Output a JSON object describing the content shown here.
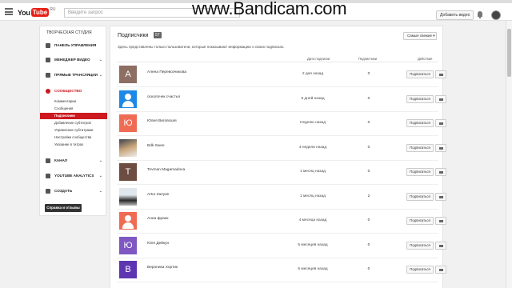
{
  "header": {
    "logo_you": "You",
    "logo_tube": "Tube",
    "logo_sup": "RU",
    "search_text": "Введите запрос",
    "upload_label": "Добавить видео",
    "watermark": "www.Bandicam.com"
  },
  "sidebar": {
    "title": "ТВОРЧЕСКАЯ СТУДИЯ",
    "items": [
      {
        "label": "ПАНЕЛЬ УПРАВЛЕНИЯ",
        "icon": "dashboard-icon"
      },
      {
        "label": "МЕНЕДЖЕР ВИДЕО",
        "icon": "video-manager-icon",
        "chevron": "⌄"
      },
      {
        "label": "ПРЯМЫЕ ТРАНСЛЯЦИИ",
        "icon": "live-icon",
        "chevron": "⌄"
      },
      {
        "label": "СООБЩЕСТВО",
        "icon": "community-icon",
        "chevron": "⌄"
      }
    ],
    "community_sub": [
      "Комментарии",
      "Сообщения",
      "Подписчики",
      "Добавление субтитров",
      "Управление субтитрами",
      "Настройки сообщества",
      "Указание в титрах"
    ],
    "bottom_items": [
      {
        "label": "КАНАЛ",
        "icon": "channel-icon",
        "chevron": "⌄"
      },
      {
        "label": "YOUTUBE ANALYTICS",
        "icon": "analytics-icon",
        "chevron": "⌄"
      },
      {
        "label": "СОЗДАТЬ",
        "icon": "create-icon",
        "chevron": "⌄"
      }
    ],
    "help_label": "Справка и отзывы"
  },
  "main": {
    "title": "Подписчики",
    "count": "57",
    "description": "Здесь представлены только пользователи, которые показывают информацию о своих подписках.",
    "sort_label": "Самые свежие",
    "columns": {
      "date": "Дата подписки",
      "subs": "Подписчики",
      "actions": "Действия"
    },
    "rows": [
      {
        "initial": "А",
        "color": "#8d6e63",
        "kind": "letter",
        "name": "Алена Перевозчикова",
        "date": "2 дня назад",
        "count": "0",
        "btn": "Подписаться"
      },
      {
        "initial": "",
        "color": "#1e88e5",
        "kind": "user",
        "name": "осколочек счастья",
        "date": "6 дней назад",
        "count": "0",
        "btn": "Подписаться"
      },
      {
        "initial": "Ю",
        "color": "#ef6c54",
        "kind": "letter",
        "name": "Юлия Виговская",
        "date": "Неделю назад",
        "count": "0",
        "btn": "Подписаться"
      },
      {
        "initial": "",
        "color": "#7a7a5a",
        "kind": "photo",
        "name": "Bdk Swee",
        "date": "4 недели назад",
        "count": "0",
        "btn": "Подписаться"
      },
      {
        "initial": "T",
        "color": "#6d4c41",
        "kind": "letter",
        "name": "Tovman Magamadova",
        "date": "1 месяц назад",
        "count": "0",
        "btn": "Подписаться"
      },
      {
        "initial": "",
        "color": "#888888",
        "kind": "photo3",
        "name": "Artur Zazyan",
        "date": "1 месяц назад",
        "count": "2",
        "btn": "Подписаться"
      },
      {
        "initial": "",
        "color": "#ef6c54",
        "kind": "user-orange",
        "name": "Анна франк",
        "date": "4 месяца назад",
        "count": "0",
        "btn": "Подписаться"
      },
      {
        "initial": "Ю",
        "color": "#7e57c2",
        "kind": "letter",
        "name": "Юля Дейкун",
        "date": "5 месяцев назад",
        "count": "0",
        "btn": "Подписаться"
      },
      {
        "initial": "В",
        "color": "#5e35b1",
        "kind": "letter",
        "name": "Вероника Хортик",
        "date": "6 месяцев назад",
        "count": "0",
        "btn": "Подписаться"
      }
    ]
  }
}
